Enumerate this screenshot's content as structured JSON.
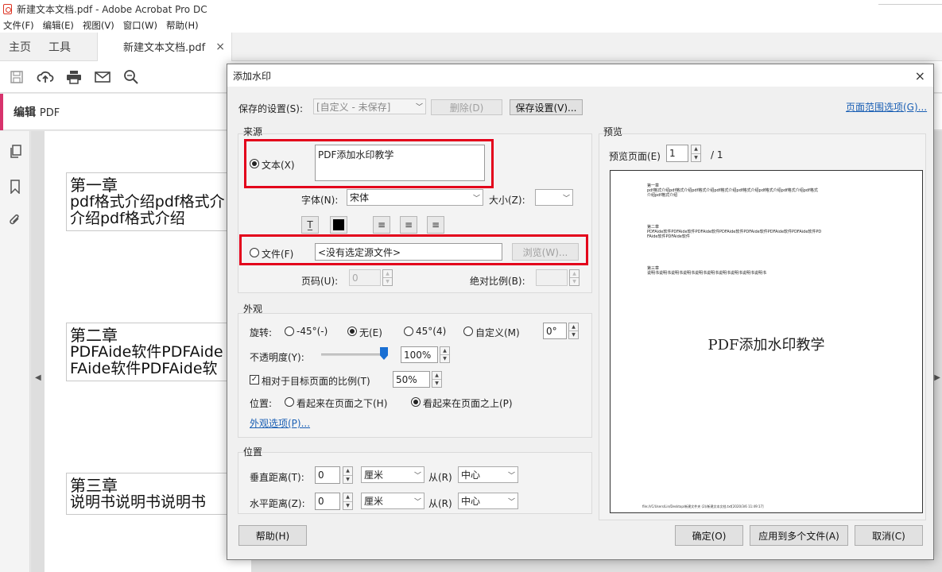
{
  "window": {
    "title": "新建文本文档.pdf - Adobe Acrobat Pro DC"
  },
  "menu": [
    "文件(F)",
    "编辑(E)",
    "视图(V)",
    "窗口(W)",
    "帮助(H)"
  ],
  "tabs": {
    "home": "主页",
    "tools": "工具",
    "doc": "新建文本文档.pdf",
    "close": "×"
  },
  "editbar": {
    "label": "编辑",
    "label_suffix": "PDF"
  },
  "document": {
    "chapters": [
      {
        "heading": "第一章",
        "lines": [
          "pdf格式介绍pdf格式介",
          "介绍pdf格式介绍"
        ]
      },
      {
        "heading": "第二章",
        "lines": [
          "PDFAide软件PDFAide",
          "FAide软件PDFAide软"
        ]
      },
      {
        "heading": "第三章",
        "lines": [
          "说明书说明书说明书"
        ]
      }
    ]
  },
  "dialog": {
    "title": "添加水印",
    "close": "×",
    "saved_settings_label": "保存的设置(S):",
    "saved_settings_value": "[自定义 - 未保存]",
    "delete_button": "删除(D)",
    "save_settings_button": "保存设置(V)...",
    "page_range_link": "页面范围选项(G)...",
    "source": {
      "title": "来源",
      "text_radio": "文本(X)",
      "text_value": "PDF添加水印教学",
      "font_label": "字体(N):",
      "font_value": "宋体",
      "size_label": "大小(Z):",
      "size_value": "",
      "file_radio": "文件(F)",
      "file_value": "<没有选定源文件>",
      "browse_button": "浏览(W)...",
      "page_label": "页码(U):",
      "page_value": "0",
      "scale_label": "绝对比例(B):",
      "scale_value": ""
    },
    "appearance": {
      "title": "外观",
      "rotation_label": "旋转:",
      "rot_neg45": "-45°(-)",
      "rot_none": "无(E)",
      "rot_45": "45°(4)",
      "rot_custom": "自定义(M)",
      "rot_value": "0°",
      "opacity_label": "不透明度(Y):",
      "opacity_value": "100%",
      "opacity_level": 1.0,
      "relative_label": "相对于目标页面的比例(T)",
      "relative_value": "50%",
      "position_label": "位置:",
      "pos_behind": "看起来在页面之下(H)",
      "pos_front": "看起来在页面之上(P)",
      "options_link": "外观选项(P)..."
    },
    "position": {
      "title": "位置",
      "vertical_label": "垂直距离(T):",
      "vertical_value": "0",
      "vertical_unit": "厘米",
      "from1_label": "从(R)",
      "from1_value": "中心",
      "horizontal_label": "水平距离(Z):",
      "horizontal_value": "0",
      "horizontal_unit": "厘米",
      "from2_label": "从(R)",
      "from2_value": "中心"
    },
    "preview": {
      "title": "预览",
      "page_label": "预览页面(E)",
      "page_value": "1",
      "page_total": "/ 1",
      "block1_head": "第一章",
      "block1_l1": "pdf格式介绍pdf格式介绍pdf格式介绍pdf格式介绍pdf格式介绍pdf格式介绍pdf格式介绍pdf格式",
      "block1_l2": "介绍pdf格式介绍",
      "block2_head": "第二章",
      "block2_l1": "PDFAide软件PDFAide软件PDFAide软件PDFAide软件PDFAide软件PDFAide软件PDFAide软件PD",
      "block2_l2": "FAide软件PDFAide软件",
      "block3_head": "第三章",
      "block3_l1": "说明书说明书说明书说明书说明书说明书说明书说明书说明书说明书",
      "watermark": "PDF添加水印教学",
      "footer": "file:///C/Users/Lin/Desktop/新建文件夹 (2)/新建文本文档.txt[2020/3/6 11:49:17]"
    },
    "help_button": "帮助(H)",
    "ok_button": "确定(O)",
    "apply_multiple_button": "应用到多个文件(A)",
    "cancel_button": "取消(C)"
  }
}
